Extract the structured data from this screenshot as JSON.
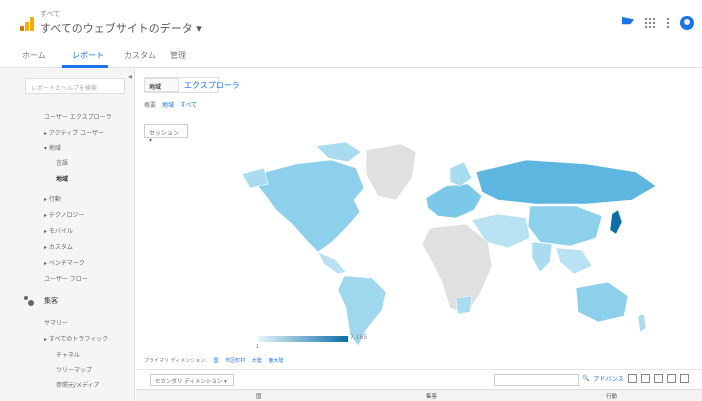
{
  "header": {
    "account": "すべて",
    "view_title": "すべてのウェブサイトのデータ ▾"
  },
  "tabs": [
    {
      "label": "ホーム"
    },
    {
      "label": "レポート"
    },
    {
      "label": "カスタム"
    },
    {
      "label": "管理"
    }
  ],
  "sidebar": {
    "search_placeholder": "レポートとヘルプを検索",
    "collapse": "◂",
    "items": [
      {
        "label": "ユーザー エクスプローラ"
      },
      {
        "label": "▸ アクティブ ユーザー"
      },
      {
        "label": "▾ 地域"
      },
      {
        "label": "言語"
      },
      {
        "label": "地域"
      },
      {
        "label": "▸ 行動"
      },
      {
        "label": "▸ テクノロジー"
      },
      {
        "label": "▸ モバイル"
      },
      {
        "label": "▸ カスタム"
      },
      {
        "label": "▸ ベンチマーク"
      },
      {
        "label": "ユーザー フロー"
      }
    ],
    "section_label": "集客",
    "section_items": [
      {
        "label": "サマリー"
      },
      {
        "label": "▸ すべてのトラフィック"
      },
      {
        "label": "チャネル"
      },
      {
        "label": "ツリーマップ"
      },
      {
        "label": "参照元/メディア"
      }
    ]
  },
  "main": {
    "segment_label": "地域",
    "segment_title": "エクスプローラ",
    "crumb_label": "概要",
    "crumb_link1": "地域",
    "crumb_link2": "すべて",
    "select_button": "セッション ▾",
    "legend_min": "1",
    "legend_max": "7,165",
    "dim_label": "プライマリ ディメンション:",
    "dim_links": [
      "国",
      "市区町村",
      "大陸",
      "亜大陸"
    ],
    "secondary_dim": "セカンダリ ディメンション ▾",
    "adv_link": "アドバンス",
    "table_headers": [
      "国",
      "集客",
      "行動"
    ]
  }
}
